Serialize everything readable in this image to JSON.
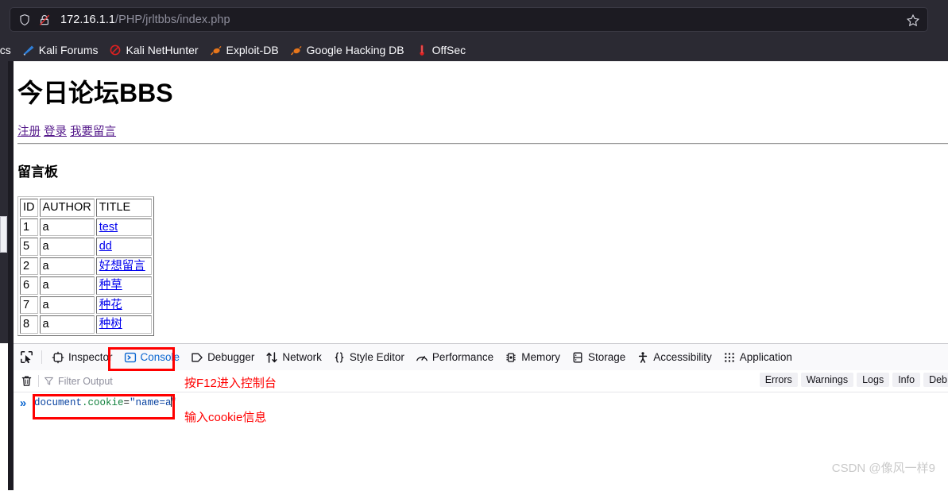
{
  "browser": {
    "url_host": "172.16.1.1",
    "url_path": "/PHP/jrltbbs/index.php",
    "shield_icon": "shield-icon",
    "lock_icon": "lock-crossed-insecure-icon",
    "star_icon": "bookmark-star-icon",
    "bookmarks": [
      {
        "label": "ocs",
        "icon": "kali-docs-icon",
        "clipped": true
      },
      {
        "label": "Kali Forums",
        "icon": "kali-forums-icon"
      },
      {
        "label": "Kali NetHunter",
        "icon": "kali-nethunter-icon"
      },
      {
        "label": "Exploit-DB",
        "icon": "exploit-db-icon"
      },
      {
        "label": "Google Hacking DB",
        "icon": "google-hacking-db-icon"
      },
      {
        "label": "OffSec",
        "icon": "offsec-icon"
      }
    ]
  },
  "page": {
    "site_title": "今日论坛BBS",
    "nav_links": [
      "注册",
      "登录",
      "我要留言"
    ],
    "board_heading": "留言板",
    "table": {
      "headers": [
        "ID",
        "AUTHOR",
        "TITLE"
      ],
      "rows": [
        {
          "id": "1",
          "author": "a",
          "title": "test"
        },
        {
          "id": "5",
          "author": "a",
          "title": "dd"
        },
        {
          "id": "2",
          "author": "a",
          "title": "好想留言"
        },
        {
          "id": "6",
          "author": "a",
          "title": "种草"
        },
        {
          "id": "7",
          "author": "a",
          "title": "种花"
        },
        {
          "id": "8",
          "author": "a",
          "title": "种树"
        }
      ]
    }
  },
  "devtools": {
    "picker_icon": "element-picker-icon",
    "tabs": [
      {
        "label": "Inspector",
        "icon": "inspector-icon",
        "selected": false
      },
      {
        "label": "Console",
        "icon": "console-prompt-icon",
        "selected": true
      },
      {
        "label": "Debugger",
        "icon": "debugger-icon",
        "selected": false
      },
      {
        "label": "Network",
        "icon": "network-arrows-icon",
        "selected": false
      },
      {
        "label": "Style Editor",
        "icon": "style-editor-braces-icon",
        "selected": false
      },
      {
        "label": "Performance",
        "icon": "performance-gauge-icon",
        "selected": false
      },
      {
        "label": "Memory",
        "icon": "memory-chip-icon",
        "selected": false
      },
      {
        "label": "Storage",
        "icon": "storage-database-icon",
        "selected": false
      },
      {
        "label": "Accessibility",
        "icon": "accessibility-person-icon",
        "selected": false
      },
      {
        "label": "Application",
        "icon": "application-grid-icon",
        "selected": false
      }
    ],
    "trash_icon": "trash-can-icon",
    "funnel_icon": "filter-funnel-icon",
    "filter_placeholder": "Filter Output",
    "severity_filters": [
      "Errors",
      "Warnings",
      "Logs",
      "Info",
      "Deb"
    ],
    "prompt_chevron": "»",
    "console_input": {
      "object": "document",
      "property": ".cookie",
      "operator": "=",
      "string": "\"name=a",
      "string_tail": "\""
    }
  },
  "annotations": {
    "note_f12": "按F12进入控制台",
    "note_cookie": "输入cookie信息",
    "box_color": "#ff0000"
  },
  "watermark": "CSDN @像风一样9"
}
